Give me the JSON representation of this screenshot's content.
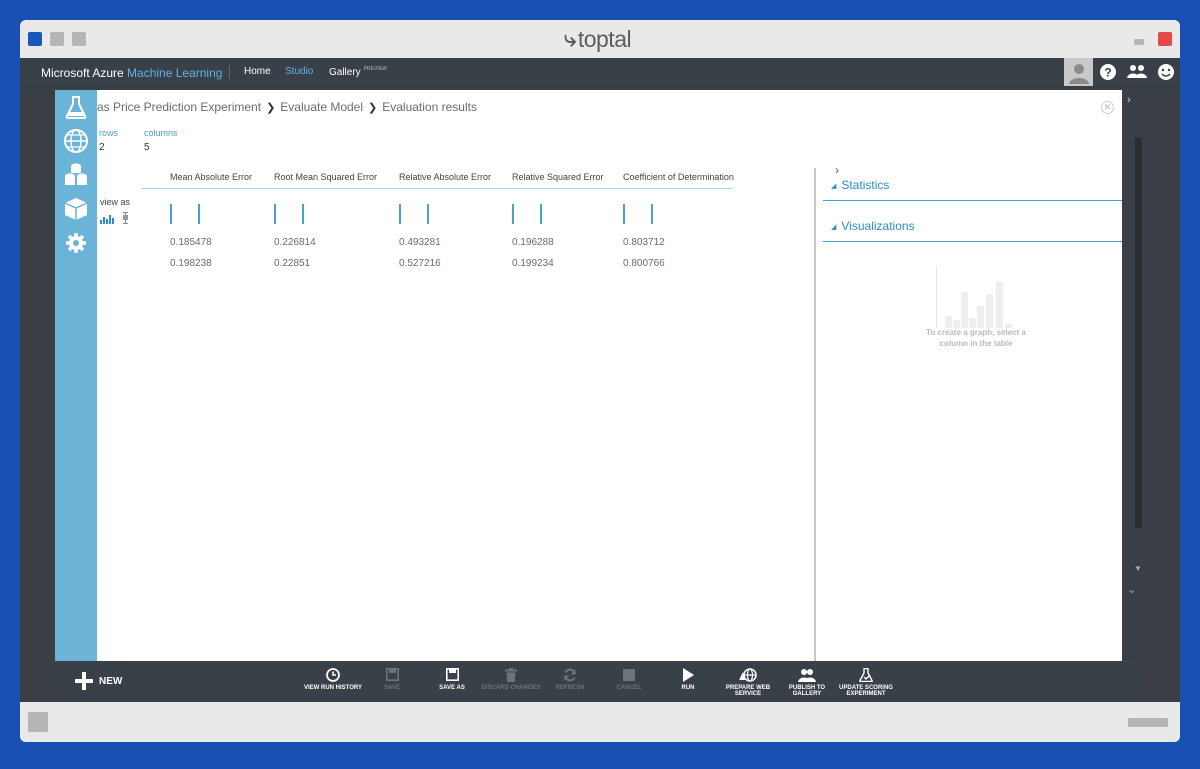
{
  "browser": {
    "brand": "toptal"
  },
  "topnav": {
    "product_plain": "Microsoft Azure",
    "product_accent": "Machine Learning",
    "links": [
      "Home",
      "Studio",
      "Gallery"
    ],
    "gallery_badge": "PREVIEW",
    "icons": [
      "avatar-icon",
      "help-icon",
      "community-icon",
      "feedback-icon"
    ]
  },
  "rail": {
    "icons": [
      "experiments-icon",
      "web-services-icon",
      "datasets-icon",
      "trained-models-icon",
      "settings-icon"
    ]
  },
  "breadcrumb": {
    "items": [
      "as Price Prediction Experiment",
      "Evaluate Model",
      "Evaluation results"
    ]
  },
  "summary": {
    "rows_label": "rows",
    "rows_value": "2",
    "columns_label": "columns",
    "columns_value": "5"
  },
  "view_as_label": "view as",
  "table": {
    "columns": [
      "Mean Absolute Error",
      "Root Mean Squared Error",
      "Relative Absolute Error",
      "Relative Squared Error",
      "Coefficient of Determination"
    ],
    "rows": [
      [
        "0.185478",
        "0.226814",
        "0.493281",
        "0.196288",
        "0.803712"
      ],
      [
        "0.198238",
        "0.22851",
        "0.527216",
        "0.199234",
        "0.800766"
      ]
    ]
  },
  "right_panel": {
    "statistics_label": "Statistics",
    "visualizations_label": "Visualizations",
    "viz_hint_line1": "To create a graph, select a",
    "viz_hint_line2": "column in the table"
  },
  "toolbar": {
    "new_label": "NEW",
    "items": [
      {
        "line1": "VIEW RUN HISTORY",
        "line2": "",
        "enabled": true,
        "icon": "history-icon"
      },
      {
        "line1": "SAVE",
        "line2": "",
        "enabled": false,
        "icon": "save-icon"
      },
      {
        "line1": "SAVE AS",
        "line2": "",
        "enabled": true,
        "icon": "save-as-icon"
      },
      {
        "line1": "DISCARD CHANGES",
        "line2": "",
        "enabled": false,
        "icon": "trash-icon"
      },
      {
        "line1": "REFRESH",
        "line2": "",
        "enabled": false,
        "icon": "refresh-icon"
      },
      {
        "line1": "CANCEL",
        "line2": "",
        "enabled": false,
        "icon": "stop-icon"
      },
      {
        "line1": "RUN",
        "line2": "",
        "enabled": true,
        "icon": "play-icon"
      },
      {
        "line1": "PREPARE WEB",
        "line2": "SERVICE",
        "enabled": true,
        "icon": "web-service-icon"
      },
      {
        "line1": "PUBLISH TO",
        "line2": "GALLERY",
        "enabled": true,
        "icon": "publish-icon"
      },
      {
        "line1": "UPDATE SCORING",
        "line2": "EXPERIMENT",
        "enabled": true,
        "icon": "flask-icon"
      }
    ]
  },
  "colors": {
    "accent": "#4a9fd0",
    "rail": "#6cb3d8",
    "chrome_dark": "#3a4048",
    "outer_bg": "#1a4fb3"
  }
}
